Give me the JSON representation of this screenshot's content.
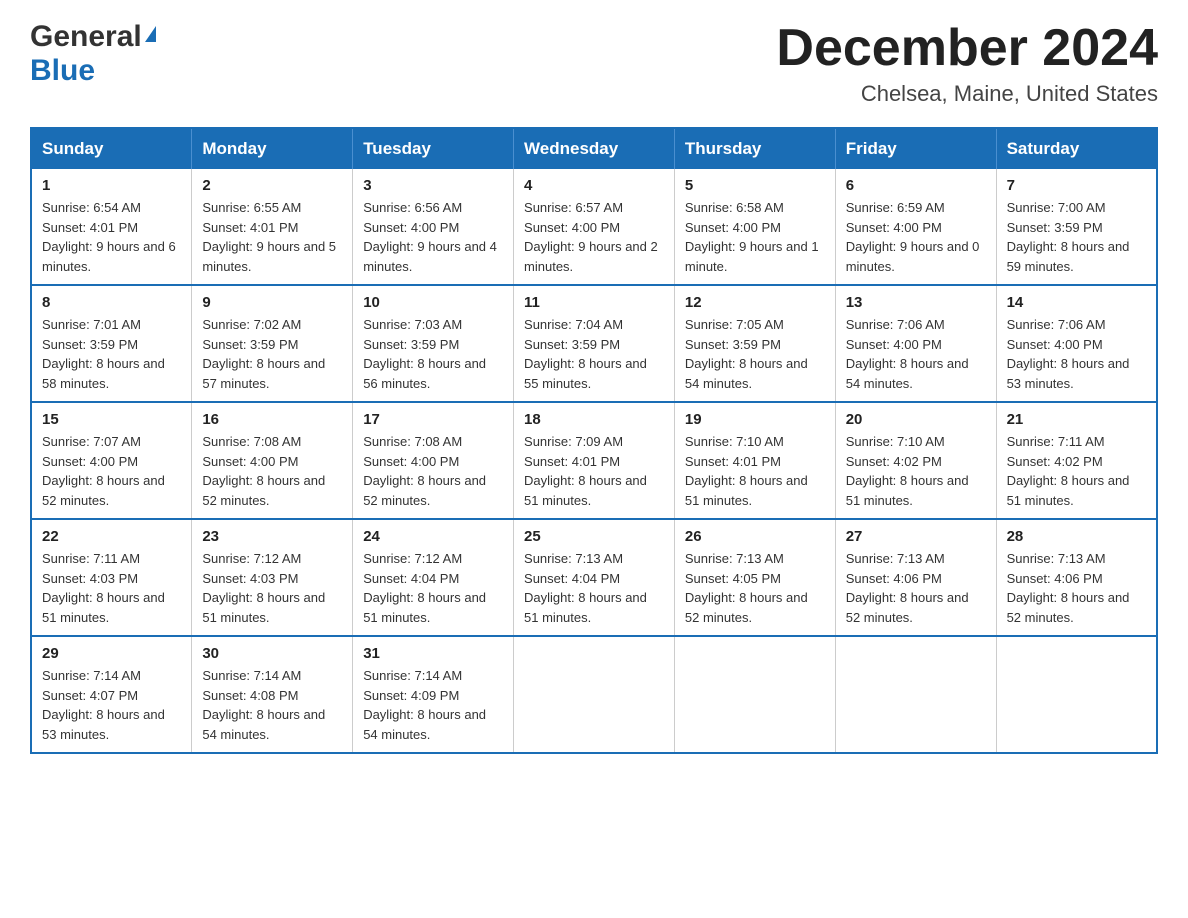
{
  "header": {
    "logo_general": "General",
    "logo_blue": "Blue",
    "month_title": "December 2024",
    "location": "Chelsea, Maine, United States"
  },
  "days_of_week": [
    "Sunday",
    "Monday",
    "Tuesday",
    "Wednesday",
    "Thursday",
    "Friday",
    "Saturday"
  ],
  "weeks": [
    [
      {
        "day": "1",
        "sunrise": "6:54 AM",
        "sunset": "4:01 PM",
        "daylight": "9 hours and 6 minutes."
      },
      {
        "day": "2",
        "sunrise": "6:55 AM",
        "sunset": "4:01 PM",
        "daylight": "9 hours and 5 minutes."
      },
      {
        "day": "3",
        "sunrise": "6:56 AM",
        "sunset": "4:00 PM",
        "daylight": "9 hours and 4 minutes."
      },
      {
        "day": "4",
        "sunrise": "6:57 AM",
        "sunset": "4:00 PM",
        "daylight": "9 hours and 2 minutes."
      },
      {
        "day": "5",
        "sunrise": "6:58 AM",
        "sunset": "4:00 PM",
        "daylight": "9 hours and 1 minute."
      },
      {
        "day": "6",
        "sunrise": "6:59 AM",
        "sunset": "4:00 PM",
        "daylight": "9 hours and 0 minutes."
      },
      {
        "day": "7",
        "sunrise": "7:00 AM",
        "sunset": "3:59 PM",
        "daylight": "8 hours and 59 minutes."
      }
    ],
    [
      {
        "day": "8",
        "sunrise": "7:01 AM",
        "sunset": "3:59 PM",
        "daylight": "8 hours and 58 minutes."
      },
      {
        "day": "9",
        "sunrise": "7:02 AM",
        "sunset": "3:59 PM",
        "daylight": "8 hours and 57 minutes."
      },
      {
        "day": "10",
        "sunrise": "7:03 AM",
        "sunset": "3:59 PM",
        "daylight": "8 hours and 56 minutes."
      },
      {
        "day": "11",
        "sunrise": "7:04 AM",
        "sunset": "3:59 PM",
        "daylight": "8 hours and 55 minutes."
      },
      {
        "day": "12",
        "sunrise": "7:05 AM",
        "sunset": "3:59 PM",
        "daylight": "8 hours and 54 minutes."
      },
      {
        "day": "13",
        "sunrise": "7:06 AM",
        "sunset": "4:00 PM",
        "daylight": "8 hours and 54 minutes."
      },
      {
        "day": "14",
        "sunrise": "7:06 AM",
        "sunset": "4:00 PM",
        "daylight": "8 hours and 53 minutes."
      }
    ],
    [
      {
        "day": "15",
        "sunrise": "7:07 AM",
        "sunset": "4:00 PM",
        "daylight": "8 hours and 52 minutes."
      },
      {
        "day": "16",
        "sunrise": "7:08 AM",
        "sunset": "4:00 PM",
        "daylight": "8 hours and 52 minutes."
      },
      {
        "day": "17",
        "sunrise": "7:08 AM",
        "sunset": "4:00 PM",
        "daylight": "8 hours and 52 minutes."
      },
      {
        "day": "18",
        "sunrise": "7:09 AM",
        "sunset": "4:01 PM",
        "daylight": "8 hours and 51 minutes."
      },
      {
        "day": "19",
        "sunrise": "7:10 AM",
        "sunset": "4:01 PM",
        "daylight": "8 hours and 51 minutes."
      },
      {
        "day": "20",
        "sunrise": "7:10 AM",
        "sunset": "4:02 PM",
        "daylight": "8 hours and 51 minutes."
      },
      {
        "day": "21",
        "sunrise": "7:11 AM",
        "sunset": "4:02 PM",
        "daylight": "8 hours and 51 minutes."
      }
    ],
    [
      {
        "day": "22",
        "sunrise": "7:11 AM",
        "sunset": "4:03 PM",
        "daylight": "8 hours and 51 minutes."
      },
      {
        "day": "23",
        "sunrise": "7:12 AM",
        "sunset": "4:03 PM",
        "daylight": "8 hours and 51 minutes."
      },
      {
        "day": "24",
        "sunrise": "7:12 AM",
        "sunset": "4:04 PM",
        "daylight": "8 hours and 51 minutes."
      },
      {
        "day": "25",
        "sunrise": "7:13 AM",
        "sunset": "4:04 PM",
        "daylight": "8 hours and 51 minutes."
      },
      {
        "day": "26",
        "sunrise": "7:13 AM",
        "sunset": "4:05 PM",
        "daylight": "8 hours and 52 minutes."
      },
      {
        "day": "27",
        "sunrise": "7:13 AM",
        "sunset": "4:06 PM",
        "daylight": "8 hours and 52 minutes."
      },
      {
        "day": "28",
        "sunrise": "7:13 AM",
        "sunset": "4:06 PM",
        "daylight": "8 hours and 52 minutes."
      }
    ],
    [
      {
        "day": "29",
        "sunrise": "7:14 AM",
        "sunset": "4:07 PM",
        "daylight": "8 hours and 53 minutes."
      },
      {
        "day": "30",
        "sunrise": "7:14 AM",
        "sunset": "4:08 PM",
        "daylight": "8 hours and 54 minutes."
      },
      {
        "day": "31",
        "sunrise": "7:14 AM",
        "sunset": "4:09 PM",
        "daylight": "8 hours and 54 minutes."
      },
      null,
      null,
      null,
      null
    ]
  ],
  "labels": {
    "sunrise": "Sunrise:",
    "sunset": "Sunset:",
    "daylight": "Daylight:"
  }
}
